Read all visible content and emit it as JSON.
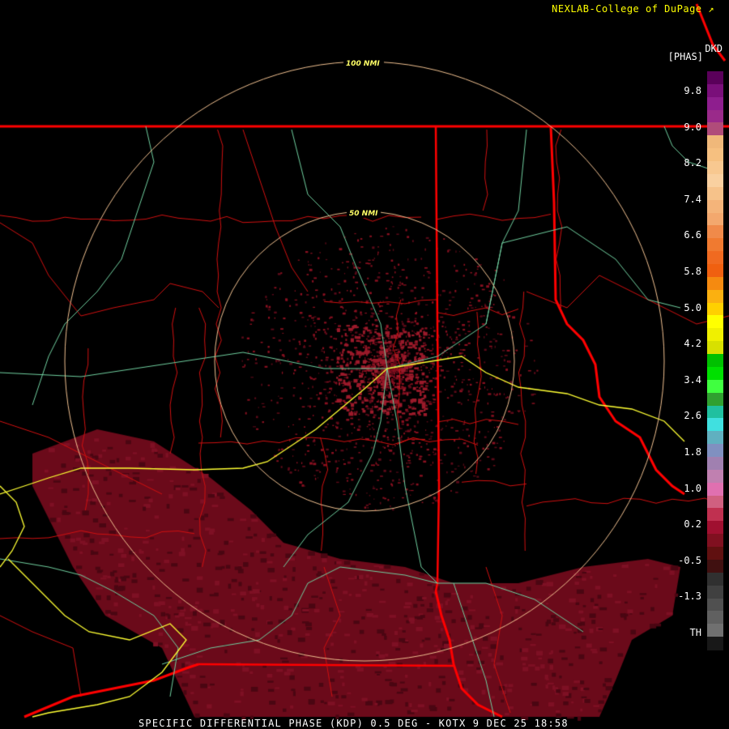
{
  "header": {
    "title": "NEXLAB-College of DuPage"
  },
  "station_label": "DKD",
  "units_label": "[PHAS]",
  "footer": "SPECIFIC DIFFERENTIAL PHASE (KDP) 0.5 DEG - KOTX 9 DEC 25 18:58",
  "range_rings": [
    "100 NMI",
    "50 NMI"
  ],
  "legend": {
    "ticks": [
      "9.8",
      "9.0",
      "8.2",
      "7.4",
      "6.6",
      "5.8",
      "5.0",
      "4.2",
      "3.4",
      "2.6",
      "1.8",
      "1.0",
      "0.2",
      "-0.5",
      "-1.3",
      "TH"
    ],
    "colors": [
      "#5a005a",
      "#7a0f7a",
      "#8e1e8e",
      "#9a2a8a",
      "#b04c7a",
      "#f0b87a",
      "#f6c080",
      "#f8c890",
      "#f9d0a0",
      "#f6c28a",
      "#f4b47a",
      "#f3a86e",
      "#f08a4a",
      "#f07a30",
      "#f06a20",
      "#f06010",
      "#f58a10",
      "#fbb010",
      "#ffd000",
      "#ffff00",
      "#f0f000",
      "#d8e000",
      "#00c000",
      "#00e000",
      "#40ff40",
      "#30a030",
      "#20c0a0",
      "#40e0e0",
      "#60b0c0",
      "#8090c0",
      "#a080b0",
      "#c080b0",
      "#e070b0",
      "#d06080",
      "#c03050",
      "#a01030",
      "#801020",
      "#601010",
      "#401010",
      "#303030",
      "#404040",
      "#505050",
      "#606060",
      "#707070",
      "#181818"
    ]
  },
  "colors": {
    "background": "#000000",
    "state_border": "#ff0000",
    "county_border": "#d01010",
    "interstate": "#ffff33",
    "highway": "#70d0a0",
    "range_ring": "#f0c090",
    "kdp_echo": "#6b0a1a",
    "kdp_speckle": "#8a1020"
  }
}
